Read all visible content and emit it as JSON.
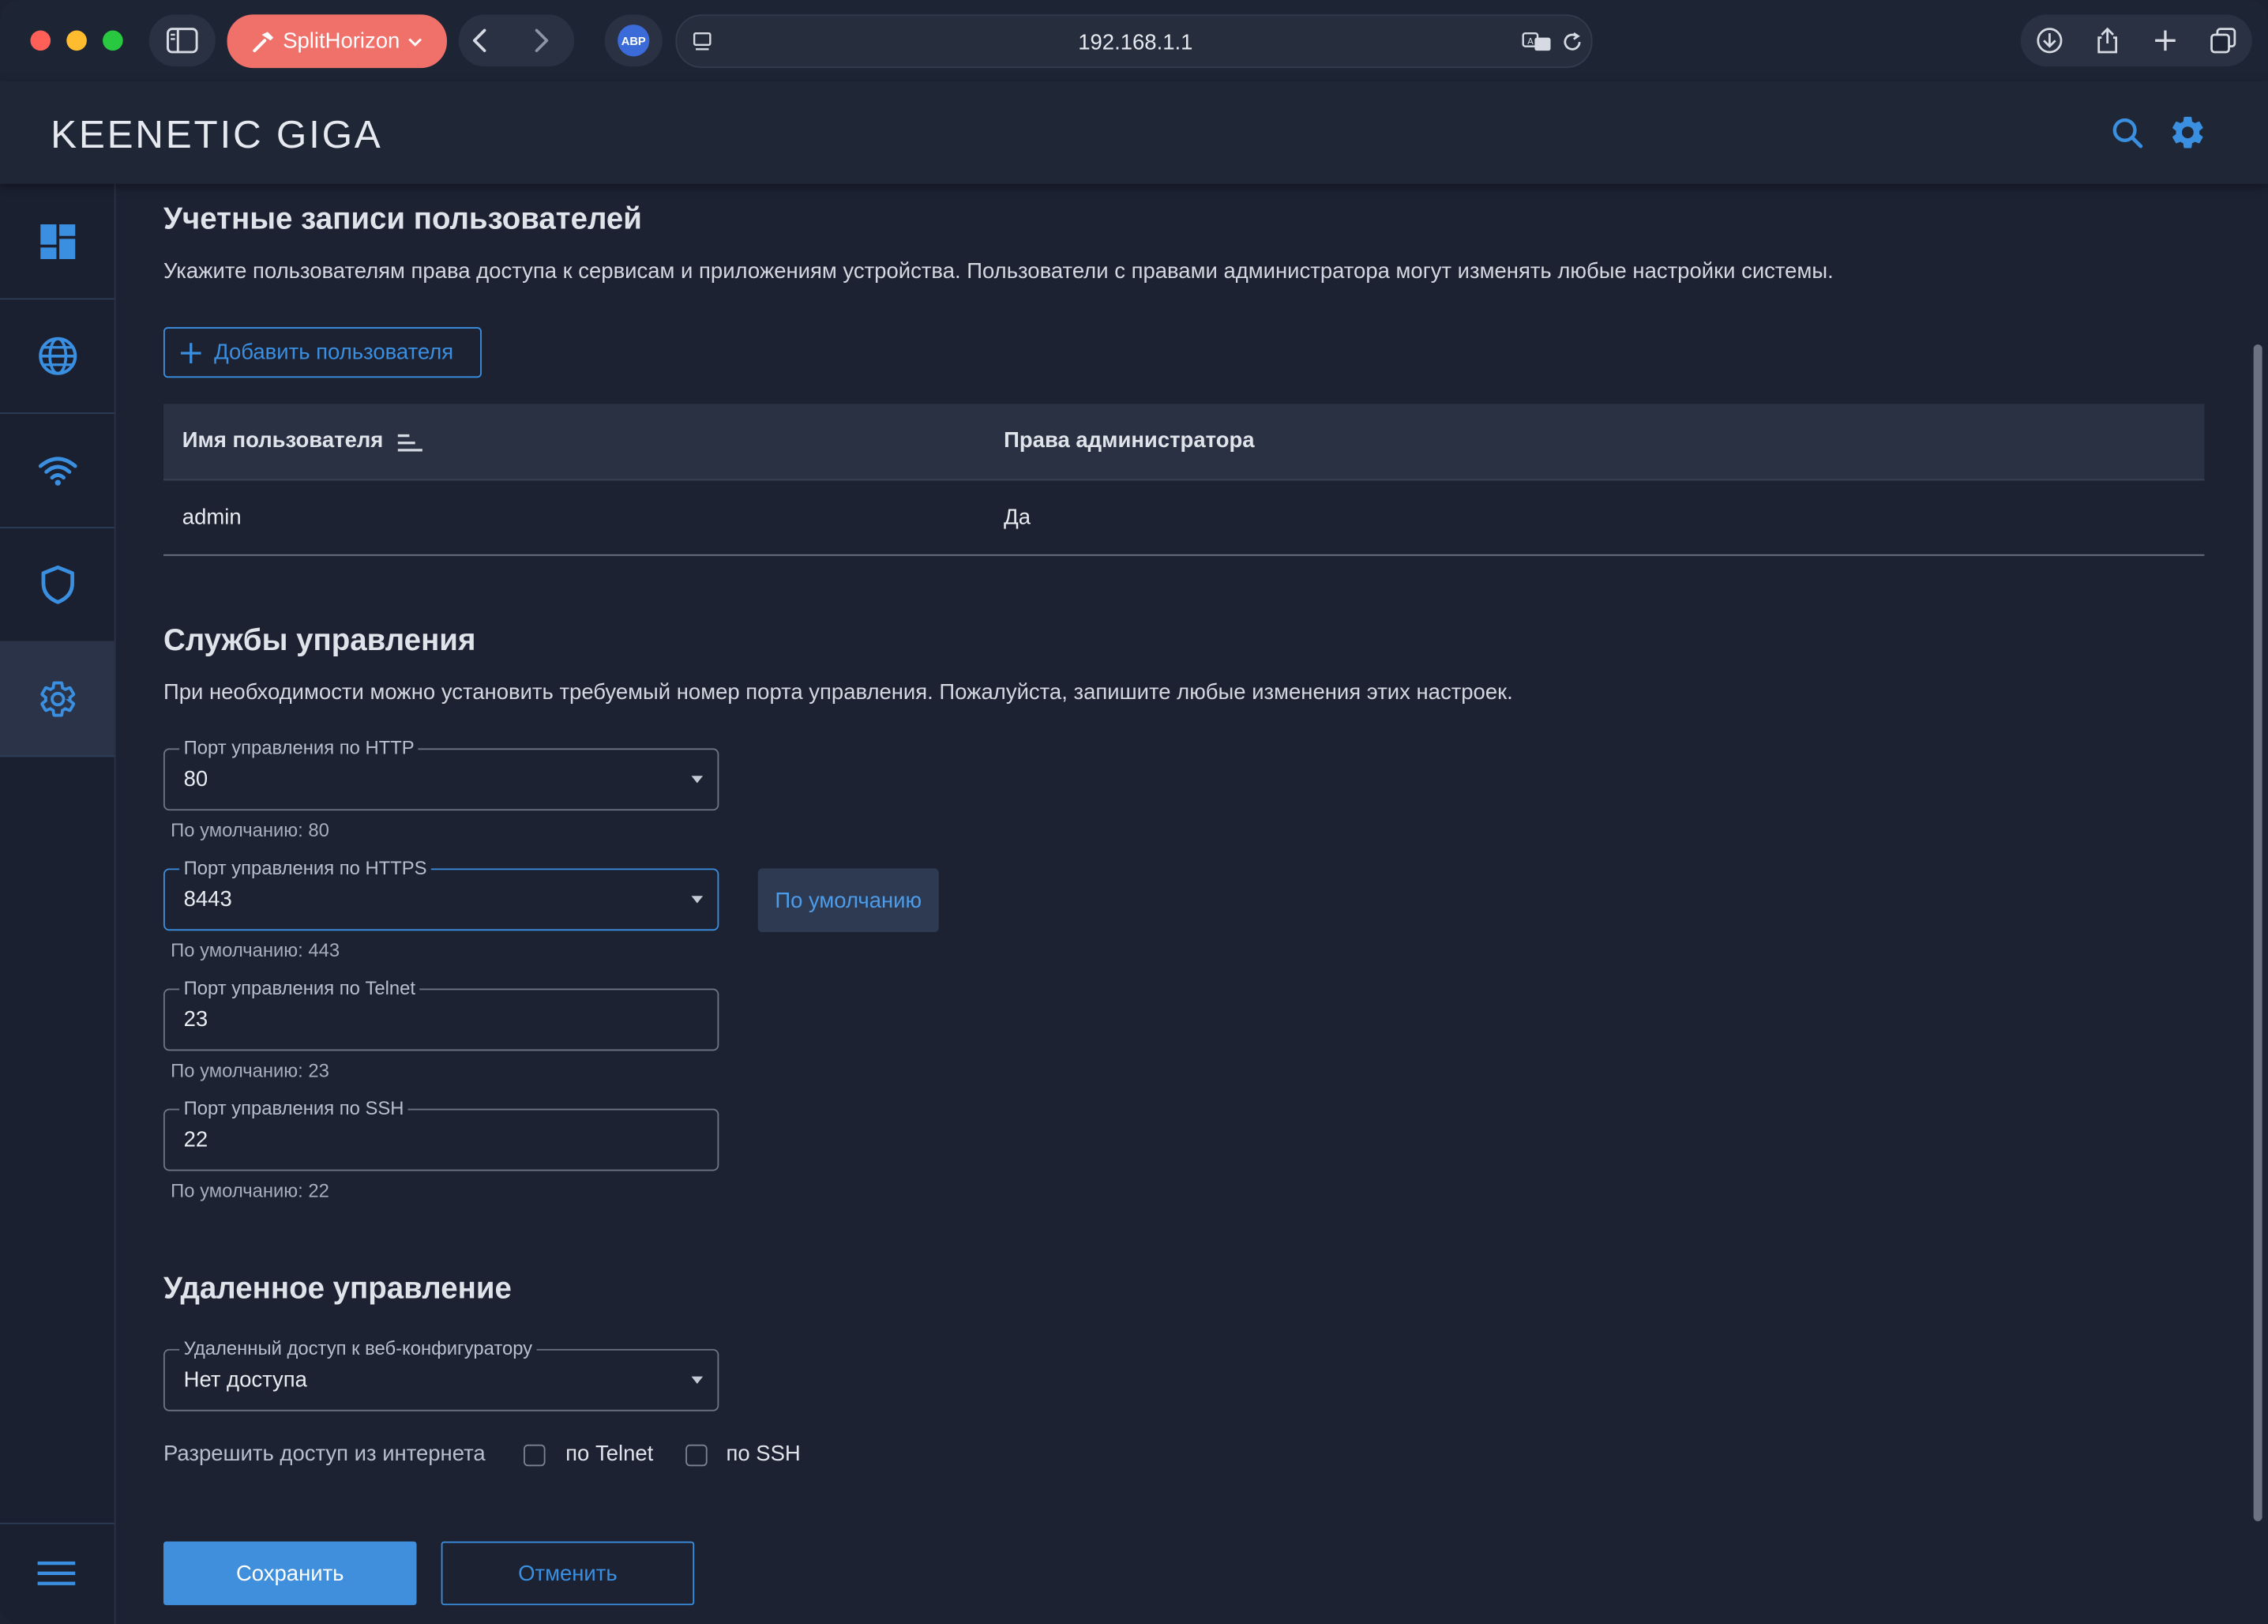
{
  "browser": {
    "profile_label": "SplitHorizon",
    "url": "192.168.1.1",
    "extension_label": "ABP"
  },
  "app": {
    "logo": "KEENETIC GIGA"
  },
  "users_section": {
    "title": "Учетные записи пользователей",
    "description": "Укажите пользователям права доступа к сервисам и приложениям устройства. Пользователи с правами администратора могут изменять любые настройки системы.",
    "add_button": "Добавить пользователя",
    "columns": [
      "Имя пользователя",
      "Права администратора"
    ],
    "rows": [
      {
        "username": "admin",
        "admin": "Да"
      }
    ]
  },
  "services_section": {
    "title": "Службы управления",
    "description": "При необходимости можно установить требуемый номер порта управления. Пожалуйста, запишите любые изменения этих настроек.",
    "http": {
      "label": "Порт управления по HTTP",
      "value": "80",
      "hint": "По умолчанию: 80"
    },
    "https": {
      "label": "Порт управления по HTTPS",
      "value": "8443",
      "hint": "По умолчанию: 443",
      "default_button": "По умолчанию"
    },
    "telnet": {
      "label": "Порт управления по Telnet",
      "value": "23",
      "hint": "По умолчанию: 23"
    },
    "ssh": {
      "label": "Порт управления по SSH",
      "value": "22",
      "hint": "По умолчанию: 22"
    }
  },
  "remote_section": {
    "title": "Удаленное управление",
    "web_access": {
      "label": "Удаленный доступ к веб-конфигуратору",
      "value": "Нет доступа"
    },
    "allow_label": "Разрешить доступ из интернета",
    "telnet_label": "по Telnet",
    "ssh_label": "по SSH",
    "telnet_checked": false,
    "ssh_checked": false
  },
  "actions": {
    "save": "Сохранить",
    "cancel": "Отменить"
  },
  "colors": {
    "accent": "#3b8fe0",
    "save_bg": "#3f8fdc",
    "background": "#1c2232",
    "profile_pill": "#f0706a"
  }
}
